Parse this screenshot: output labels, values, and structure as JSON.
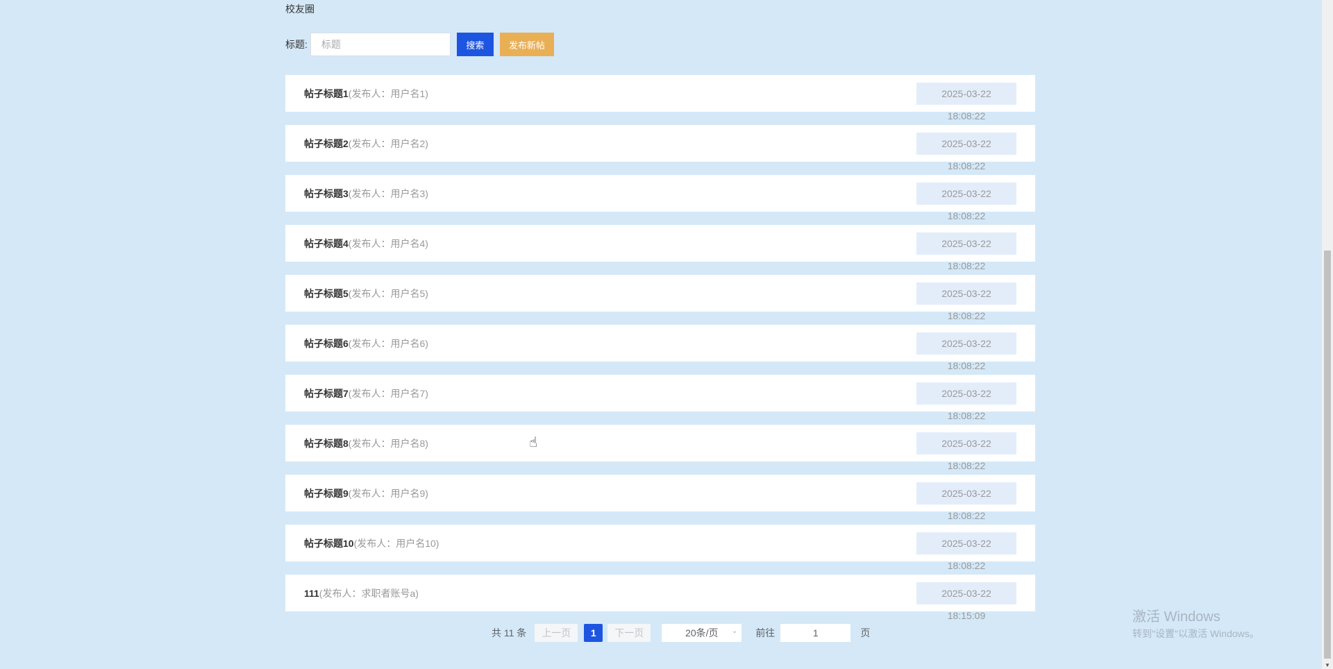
{
  "page_title": "校友圈",
  "search": {
    "label": "标题:",
    "placeholder": "标题",
    "search_button": "搜索",
    "post_button": "发布新帖"
  },
  "posts": [
    {
      "title": "帖子标题1",
      "author": "(发布人：用户名1)",
      "date": "2025-03-22 18:08:22"
    },
    {
      "title": "帖子标题2",
      "author": "(发布人：用户名2)",
      "date": "2025-03-22 18:08:22"
    },
    {
      "title": "帖子标题3",
      "author": "(发布人：用户名3)",
      "date": "2025-03-22 18:08:22"
    },
    {
      "title": "帖子标题4",
      "author": "(发布人：用户名4)",
      "date": "2025-03-22 18:08:22"
    },
    {
      "title": "帖子标题5",
      "author": "(发布人：用户名5)",
      "date": "2025-03-22 18:08:22"
    },
    {
      "title": "帖子标题6",
      "author": "(发布人：用户名6)",
      "date": "2025-03-22 18:08:22"
    },
    {
      "title": "帖子标题7",
      "author": "(发布人：用户名7)",
      "date": "2025-03-22 18:08:22"
    },
    {
      "title": "帖子标题8",
      "author": "(发布人：用户名8)",
      "date": "2025-03-22 18:08:22"
    },
    {
      "title": "帖子标题9",
      "author": "(发布人：用户名9)",
      "date": "2025-03-22 18:08:22"
    },
    {
      "title": "帖子标题10",
      "author": "(发布人：用户名10)",
      "date": "2025-03-22 18:08:22"
    },
    {
      "title": "111",
      "author": "(发布人：求职者账号a)",
      "date": "2025-03-22 18:15:09"
    }
  ],
  "pagination": {
    "total": "共 11 条",
    "prev": "上一页",
    "current": "1",
    "next": "下一页",
    "page_size": "20条/页",
    "goto_label": "前往",
    "goto_value": "1",
    "page_suffix": "页"
  },
  "watermark": {
    "line1": "激活 Windows",
    "line2": "转到\"设置\"以激活 Windows。"
  }
}
